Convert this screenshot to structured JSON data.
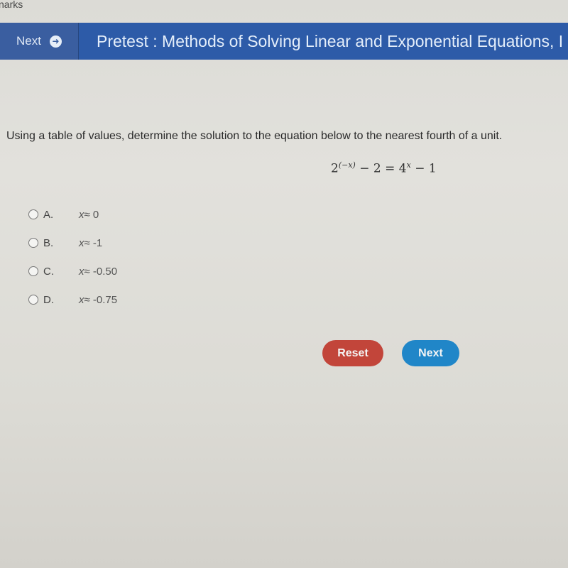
{
  "browser": {
    "bookmarks_label": "narks"
  },
  "header": {
    "nav_next_label": "Next",
    "nav_next_icon": "arrow-circle-right-icon",
    "title": "Pretest : Methods of Solving Linear and Exponential Equations, I",
    "colors": {
      "bar": "#2d5ba8",
      "nav": "#3a5ea0"
    }
  },
  "question": {
    "prompt": "Using a table of values, determine the solution to the equation below to the nearest fourth of a unit.",
    "equation": {
      "lhs_base": "2",
      "lhs_exponent": "(−x)",
      "lhs_rest": " − 2 = ",
      "rhs_base": "4",
      "rhs_exponent": "x",
      "rhs_rest": " − 1"
    }
  },
  "options": [
    {
      "letter": "A.",
      "var": "x",
      "text": "≈ 0",
      "selected": false
    },
    {
      "letter": "B.",
      "var": "x",
      "text": "≈ -1",
      "selected": false
    },
    {
      "letter": "C.",
      "var": "x",
      "text": "≈ -0.50",
      "selected": false
    },
    {
      "letter": "D.",
      "var": "x",
      "text": "≈ -0.75",
      "selected": false
    }
  ],
  "buttons": {
    "reset_label": "Reset",
    "next_label": "Next",
    "colors": {
      "reset": "#c2453a",
      "next": "#2086c8"
    }
  }
}
